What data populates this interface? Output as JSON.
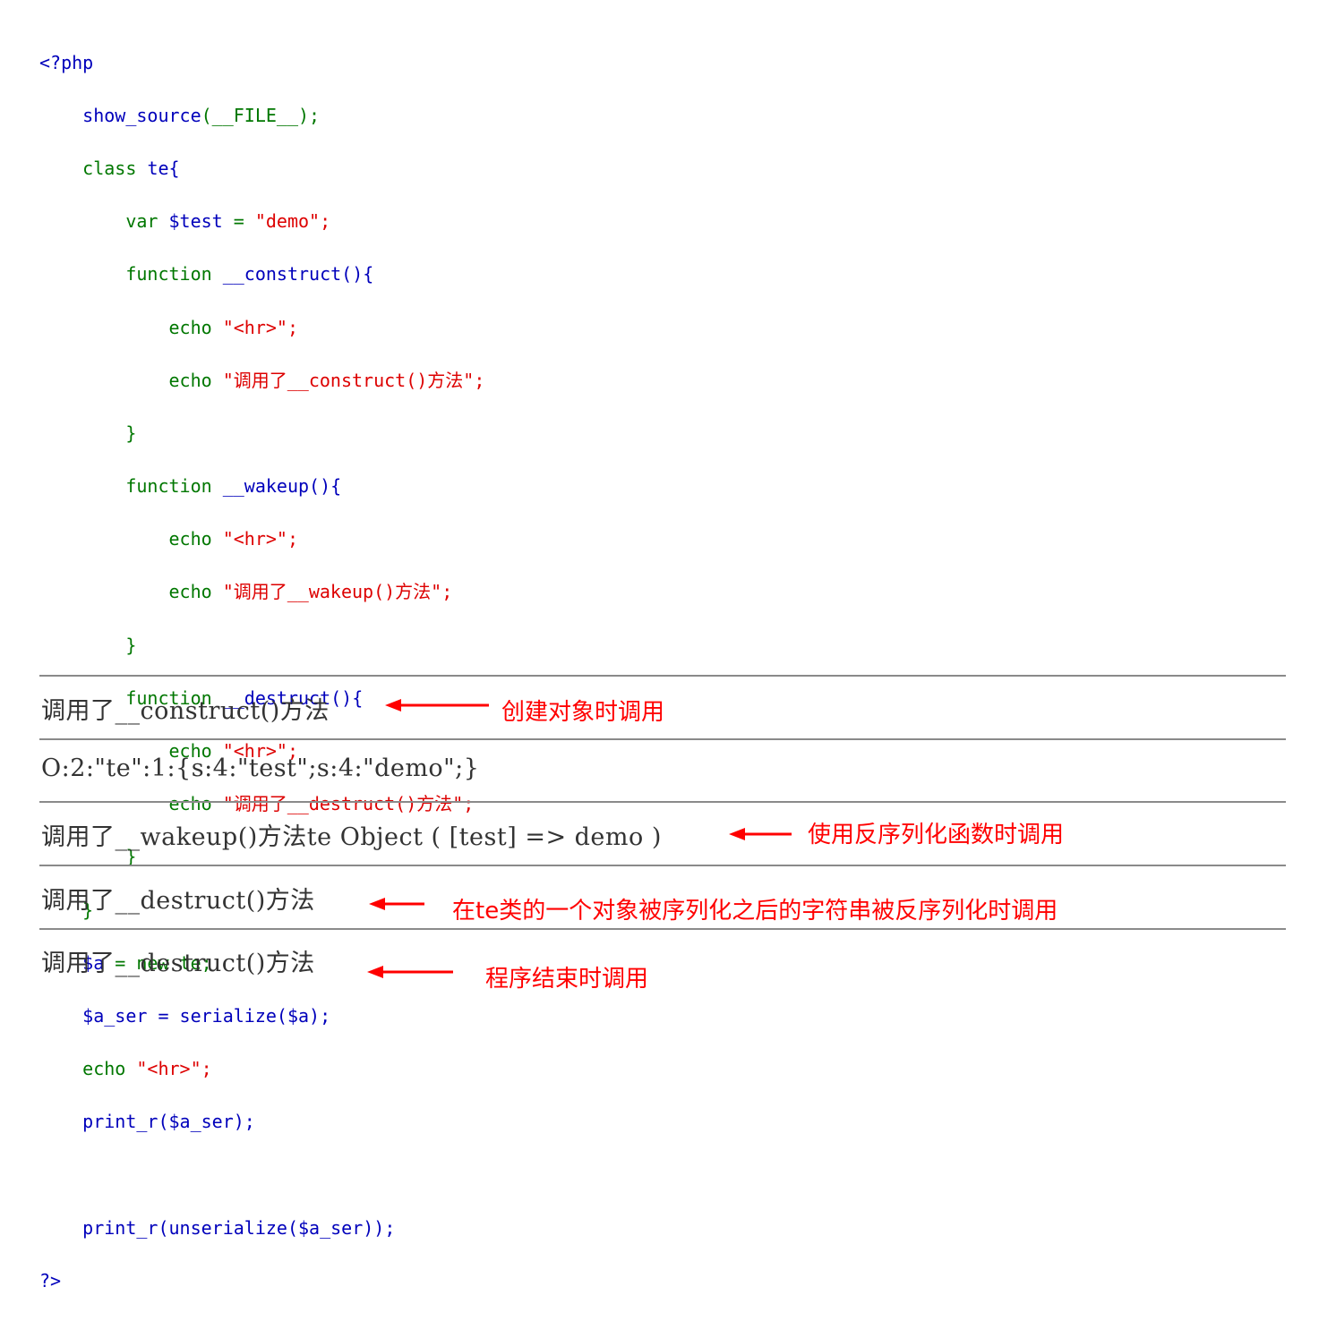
{
  "code": {
    "open_tag": "<?php",
    "show_source": "show_source",
    "show_source_arg": "(__FILE__);",
    "class_kw": "class",
    "class_name": "te{",
    "var_kw": "var",
    "var_name": "$test",
    "var_eq": " = ",
    "var_value": "\"demo\";",
    "function_kw": "function",
    "construct_name": "__construct(){",
    "wakeup_name": "__wakeup(){",
    "destruct_name": "__destruct(){",
    "echo_kw": "echo",
    "hr_str": "\"<hr>\";",
    "construct_msg": "\"调用了__construct()方法\";",
    "wakeup_msg": "\"调用了__wakeup()方法\";",
    "destruct_msg": "\"调用了__destruct()方法\";",
    "close_brace": "}",
    "new_stmt_var": "$a",
    "new_stmt_rest": " = new te;",
    "ser_var": "$a_ser = serialize($a);",
    "echo_hr_kw": "echo",
    "echo_hr_str": "\"<hr>\";",
    "print_ser": "print_r($a_ser);",
    "print_unser": "print_r(unserialize($a_ser));",
    "close_tag": "?>"
  },
  "output": {
    "line1": "调用了__construct()方法",
    "line2": "O:2:\"te\":1:{s:4:\"test\";s:4:\"demo\";}",
    "line3": "调用了__wakeup()方法te Object ( [test] => demo )",
    "line4": "调用了__destruct()方法",
    "line5": "调用了__destruct()方法"
  },
  "annotations": {
    "note1": "创建对象时调用",
    "note2": "使用反序列化函数时调用",
    "note3": "在te类的一个对象被序列化之后的字符串被反序列化时调用",
    "note4": "程序结束时调用"
  },
  "colors": {
    "keyword": "#007700",
    "function": "#0000bb",
    "string": "#dd0000",
    "annotation": "#ff0000"
  }
}
